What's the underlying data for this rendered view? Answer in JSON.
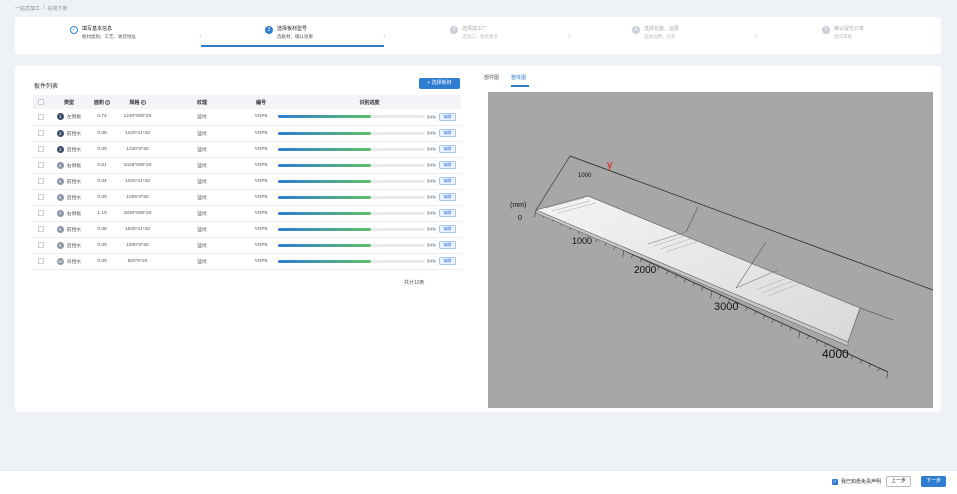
{
  "breadcrumb": [
    "一站式加工",
    "在线下单"
  ],
  "steps": [
    {
      "num": "✓",
      "title": "填写基本信息",
      "desc": "板材类别、工艺、收货地址",
      "state": "done"
    },
    {
      "num": "2",
      "title": "选择板材型号",
      "desc": "选板材、确认效果",
      "state": "active"
    },
    {
      "num": "3",
      "title": "选择加工厂",
      "desc": "选加工、收货要求",
      "state": "todo"
    },
    {
      "num": "4",
      "title": "选择包装、运费",
      "desc": "选择运费、包装",
      "state": "todo"
    },
    {
      "num": "5",
      "title": "确认提交订单",
      "desc": "提交审核",
      "state": "todo"
    }
  ],
  "panel": {
    "title": "板件列表",
    "add_button": "+ 选择板材",
    "total": "共计10条"
  },
  "table": {
    "headers": {
      "type": "类型",
      "area": "面积",
      "size": "规格",
      "texture": "纹理",
      "code": "编号",
      "progress": "识别进度"
    },
    "rows": [
      {
        "idx": "1",
        "type": "左侧板",
        "area": "0.74",
        "size": "1240*600*20",
        "texture": "竖纹",
        "code": "VGP6",
        "pct": "64%",
        "btn": "编辑"
      },
      {
        "idx": "2",
        "type": "前挡水",
        "area": "0.05",
        "size": "1240*41*20",
        "texture": "竖纹",
        "code": "VGP6",
        "pct": "64%",
        "btn": "编辑"
      },
      {
        "idx": "3",
        "type": "后挡水",
        "area": "0.00",
        "size": "1240*0*20",
        "texture": "竖纹",
        "code": "VGP6",
        "pct": "64%",
        "btn": "编辑"
      },
      {
        "idx": "4",
        "type": "右侧板",
        "area": "0.61",
        "size": "1025*600*20",
        "texture": "竖纹",
        "code": "VGP6",
        "pct": "64%",
        "btn": "编辑"
      },
      {
        "idx": "5",
        "type": "前挡水",
        "area": "0.04",
        "size": "1025*41*20",
        "texture": "竖纹",
        "code": "VGP6",
        "pct": "64%",
        "btn": "编辑"
      },
      {
        "idx": "6",
        "type": "后挡水",
        "area": "0.00",
        "size": "1025*0*20",
        "texture": "竖纹",
        "code": "VGP6",
        "pct": "64%",
        "btn": "编辑"
      },
      {
        "idx": "7",
        "type": "右侧板",
        "area": "1.10",
        "size": "1830*600*20",
        "texture": "竖纹",
        "code": "VGP6",
        "pct": "64%",
        "btn": "编辑"
      },
      {
        "idx": "8",
        "type": "前挡水",
        "area": "0.08",
        "size": "1830*41*20",
        "texture": "竖纹",
        "code": "VGP6",
        "pct": "64%",
        "btn": "编辑"
      },
      {
        "idx": "9",
        "type": "后挡水",
        "area": "0.00",
        "size": "1830*0*20",
        "texture": "竖纹",
        "code": "VGP6",
        "pct": "64%",
        "btn": "编辑"
      },
      {
        "idx": "10",
        "type": "背挡水",
        "area": "0.00",
        "size": "600*0*20",
        "texture": "竖纹",
        "code": "VGP6",
        "pct": "64%",
        "btn": "编辑"
      }
    ]
  },
  "progress_value": 0.64,
  "tabs": [
    "部件图",
    "整体图"
  ],
  "viewer": {
    "axis_label": "y",
    "unit_label": "(mm)",
    "ticks": [
      "0",
      "1000",
      "2000",
      "3000",
      "4000"
    ],
    "top_tick": "1000"
  },
  "footer": {
    "agree_text": "我已知悉免责声明",
    "prev": "上一步",
    "next": "下一步"
  },
  "colors": {
    "primary": "#2f7dd1",
    "progress_start": "#2f7dd1",
    "progress_end": "#5cc06a",
    "viewport_bg": "#a7a7a7",
    "axis_y": "#e02020"
  }
}
